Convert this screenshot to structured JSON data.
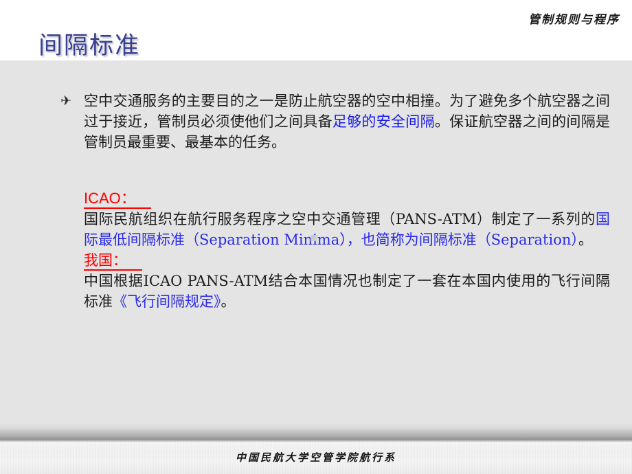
{
  "header": {
    "kicker": "管制规则与程序",
    "title": "间隔标准"
  },
  "body": {
    "bullet_icon": "✈",
    "paragraph1": {
      "part1": "空中交通服务的主要目的之一是防止航空器的空中相撞。为了避免多个航空器之间过于接近，管制员必须使他们之间具备",
      "highlight": "足够的安全间隔",
      "part2": "。保证航空器之间的间隔是管制员最重要、最基本的任务。"
    },
    "icao_section": {
      "heading": "ICAO：",
      "text_part1": "国际民航组织在航行服务程序之空中交通管理（PANS-ATM）制定了一系列的",
      "highlight1": "国际最低间隔标准（Separation Minima），也简称为间隔标准（Separation）",
      "text_part2": "。"
    },
    "china_section": {
      "heading": "我国：",
      "text_part1": "中国根据ICAO PANS-ATM结合本国情况也制定了一套在本国内使用的飞行间隔标准",
      "highlight1": "《飞行间隔规定》",
      "text_part2": "。"
    }
  },
  "footer": {
    "text": "中国民航大学空管学院航行系"
  },
  "colors": {
    "title": "#383f8f",
    "highlight_blue": "#1518e8",
    "heading_red": "#ff0000",
    "body_bg": "#e4e4e4",
    "header_bg": "#ffffff"
  }
}
